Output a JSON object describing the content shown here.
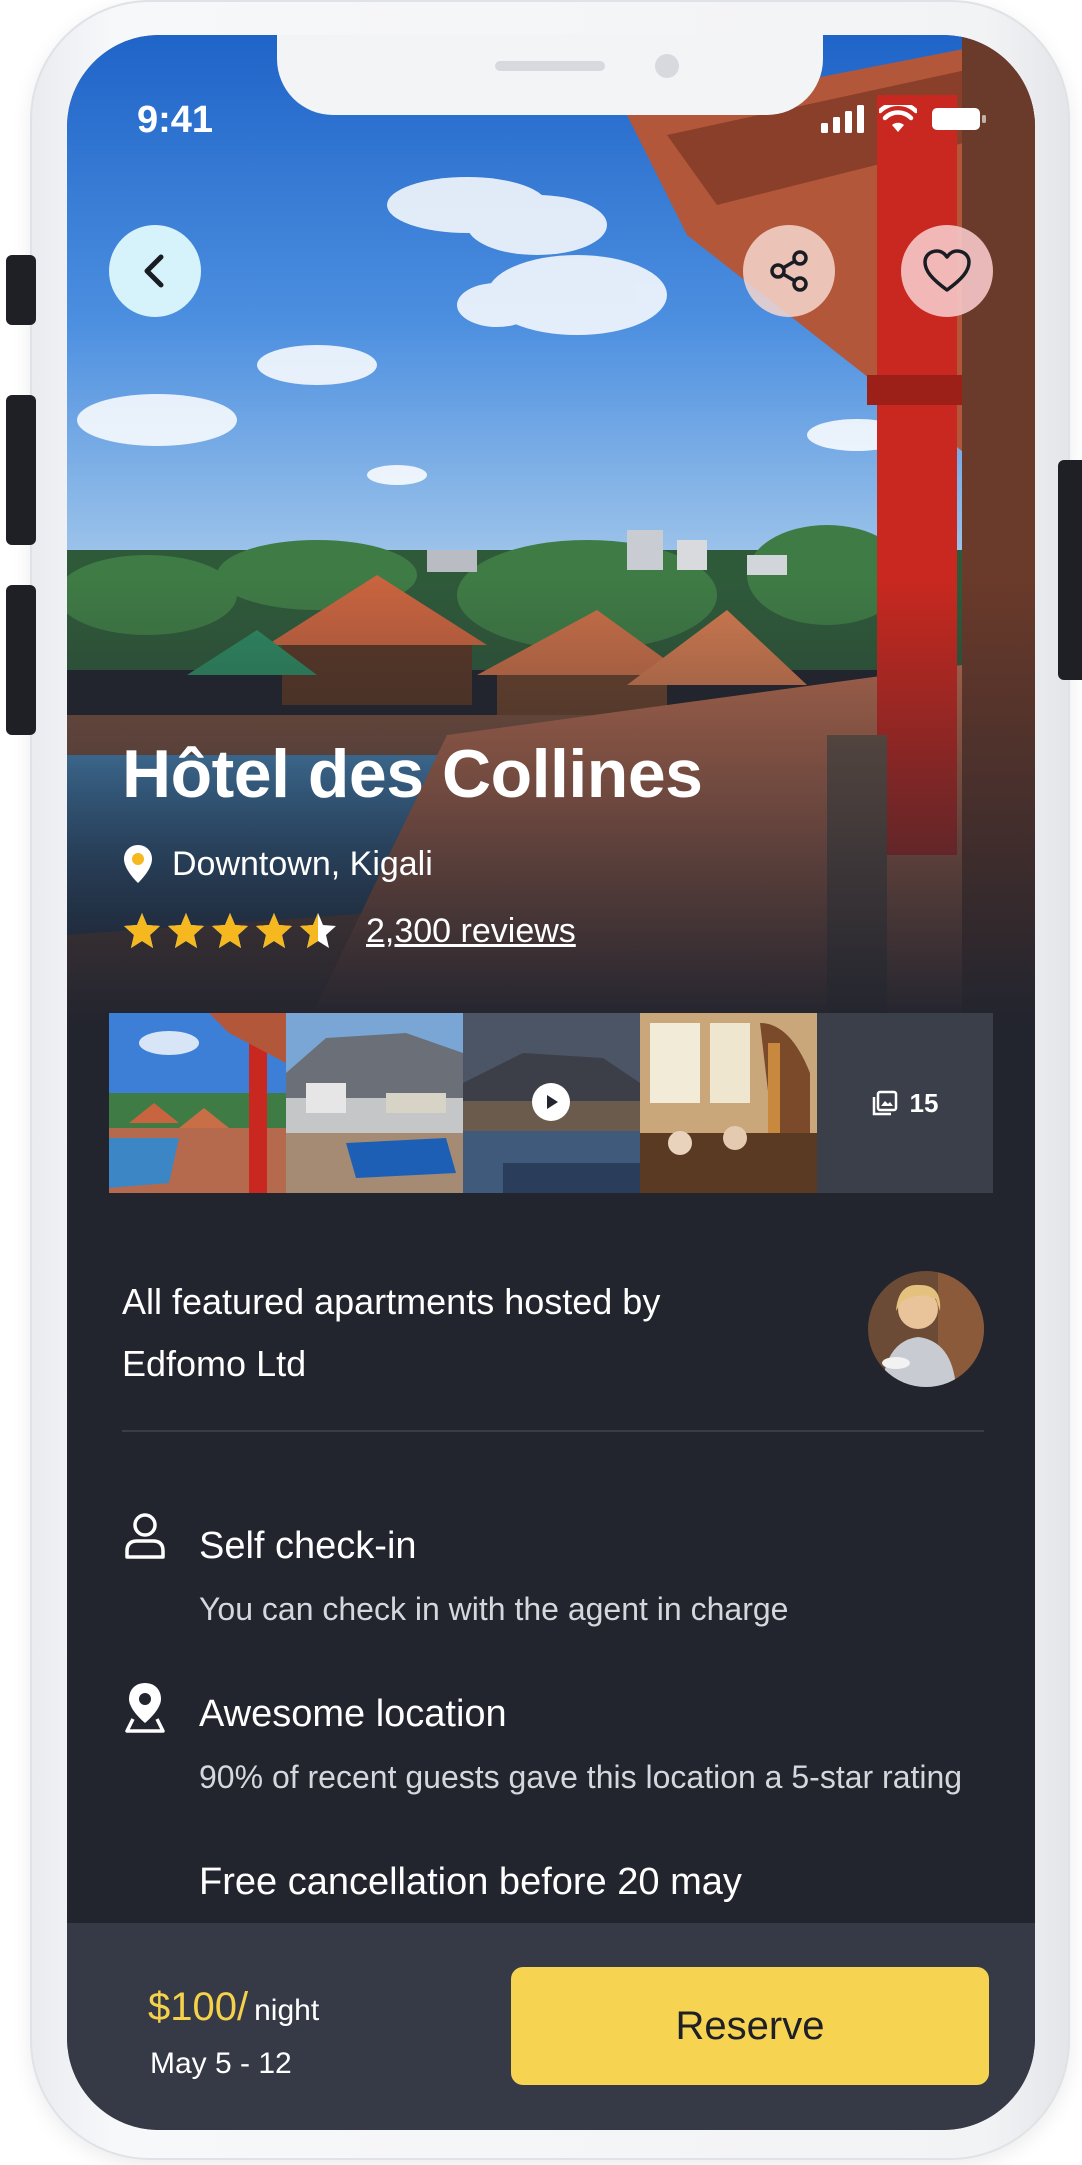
{
  "status_bar": {
    "time": "9:41"
  },
  "hotel": {
    "name": "Hôtel des Collines",
    "location": "Downtown, Kigali",
    "rating": 4.5,
    "rating_max": 5,
    "reviews_label": "2,300 reviews"
  },
  "gallery": {
    "more_count": "15"
  },
  "host": {
    "text": "All featured apartments hosted by Edfomo Ltd"
  },
  "features": [
    {
      "icon": "person-icon",
      "title": "Self check-in",
      "desc": "You can check in with the agent in charge"
    },
    {
      "icon": "location-pin-icon",
      "title": "Awesome location",
      "desc": "90% of recent guests gave this location a 5-star rating"
    },
    {
      "icon": "",
      "title": "Free cancellation before 20 may",
      "desc": ""
    }
  ],
  "booking": {
    "price": "$100/",
    "unit": "night",
    "dates": "May 5 - 12",
    "reserve_label": "Reserve"
  },
  "colors": {
    "background": "#22242e",
    "bottom_bar": "#363a46",
    "accent": "#f6d452",
    "star": "#f5b81e"
  }
}
